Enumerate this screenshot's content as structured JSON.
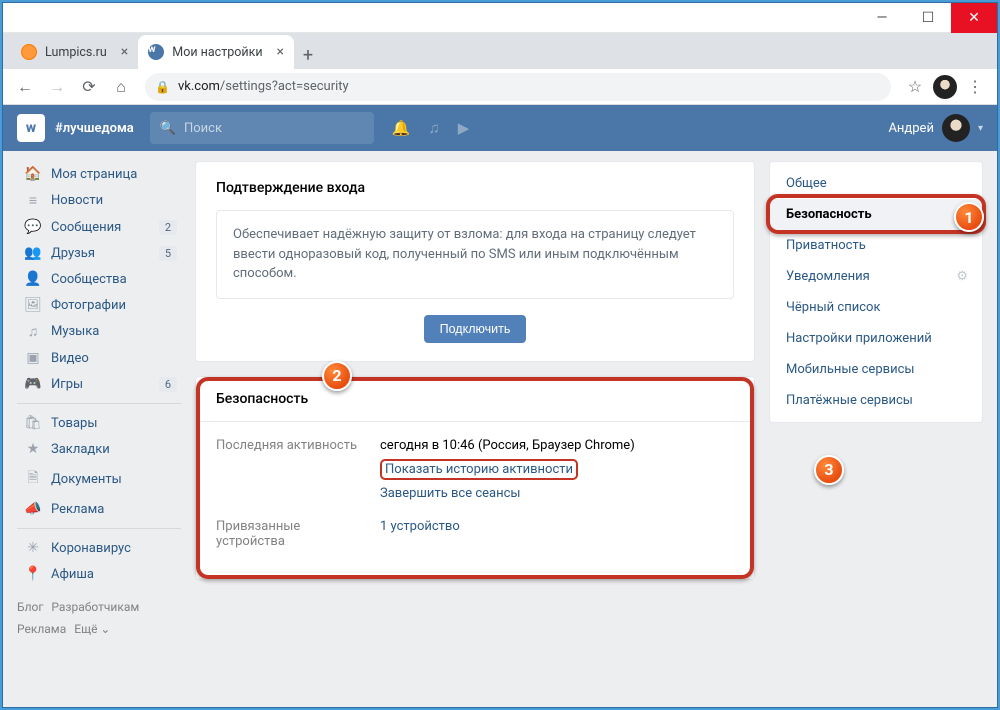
{
  "window": {
    "min": "—",
    "max": "☐",
    "close": "✕"
  },
  "tabs": [
    {
      "title": "Lumpics.ru",
      "favicon": "lumpics"
    },
    {
      "title": "Мои настройки",
      "favicon": "vk"
    }
  ],
  "address": {
    "host": "vk.com",
    "path": "/settings?act=security"
  },
  "vk_header": {
    "hashtag": "#лучшедома",
    "search_placeholder": "Поиск",
    "username": "Андрей"
  },
  "left_nav": {
    "items": [
      {
        "icon": "🏠",
        "label": "Моя страница"
      },
      {
        "icon": "≡",
        "label": "Новости"
      },
      {
        "icon": "💬",
        "label": "Сообщения",
        "badge": "2"
      },
      {
        "icon": "👥",
        "label": "Друзья",
        "badge": "5"
      },
      {
        "icon": "👤",
        "label": "Сообщества"
      },
      {
        "icon": "🖼",
        "label": "Фотографии"
      },
      {
        "icon": "♫",
        "label": "Музыка"
      },
      {
        "icon": "▣",
        "label": "Видео"
      },
      {
        "icon": "🎮",
        "label": "Игры",
        "badge": "6"
      }
    ],
    "items2": [
      {
        "icon": "🛍",
        "label": "Товары"
      },
      {
        "icon": "★",
        "label": "Закладки"
      },
      {
        "icon": "🗎",
        "label": "Документы"
      },
      {
        "icon": "📣",
        "label": "Реклама"
      }
    ],
    "items3": [
      {
        "icon": "✳",
        "label": "Коронавирус"
      },
      {
        "icon": "📍",
        "label": "Афиша"
      }
    ],
    "footer": {
      "blog": "Блог",
      "dev": "Разработчикам",
      "ads": "Реклама",
      "more": "Ещё ⌄"
    }
  },
  "main": {
    "confirm": {
      "title": "Подтверждение входа",
      "desc": "Обеспечивает надёжную защиту от взлома: для входа на страницу следует ввести одноразовый код, полученный по SMS или иным подключённым способом.",
      "button": "Подключить"
    },
    "security": {
      "title": "Безопасность",
      "last_activity_label": "Последняя активность",
      "last_activity_value": "сегодня в 10:46 (Россия, Браузер Chrome)",
      "show_history": "Показать историю активности",
      "end_sessions": "Завершить все сеансы",
      "devices_label": "Привязанные устройства",
      "devices_value": "1 устройство"
    }
  },
  "right_nav": {
    "items": [
      "Общее",
      "Безопасность",
      "Приватность",
      "Уведомления",
      "Чёрный список",
      "Настройки приложений",
      "Мобильные сервисы",
      "Платёжные сервисы"
    ]
  },
  "markers": {
    "m1": "1",
    "m2": "2",
    "m3": "3"
  }
}
